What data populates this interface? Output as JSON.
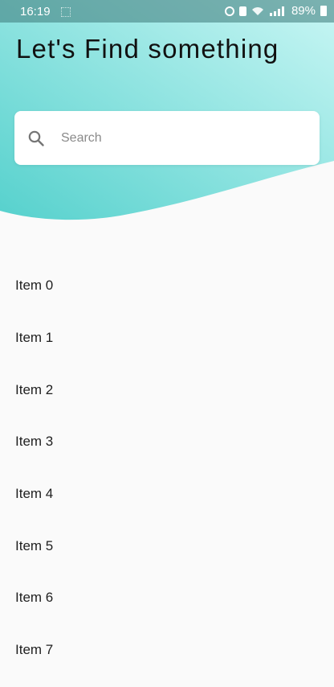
{
  "status_bar": {
    "time": "16:19",
    "battery": "89%"
  },
  "header": {
    "title": "Let's Find something"
  },
  "search": {
    "placeholder": "Search",
    "value": ""
  },
  "list": {
    "items": [
      {
        "label": "Item 0"
      },
      {
        "label": "Item 1"
      },
      {
        "label": "Item 2"
      },
      {
        "label": "Item 3"
      },
      {
        "label": "Item 4"
      },
      {
        "label": "Item 5"
      },
      {
        "label": "Item 6"
      },
      {
        "label": "Item 7"
      }
    ]
  },
  "colors": {
    "wave_start": "#56d1cd",
    "wave_end": "#c8f6f4",
    "background": "#fafafa"
  },
  "icons": {
    "search": "search-icon",
    "wifi": "wifi-icon",
    "signal": "signal-icon",
    "battery": "battery-icon"
  }
}
